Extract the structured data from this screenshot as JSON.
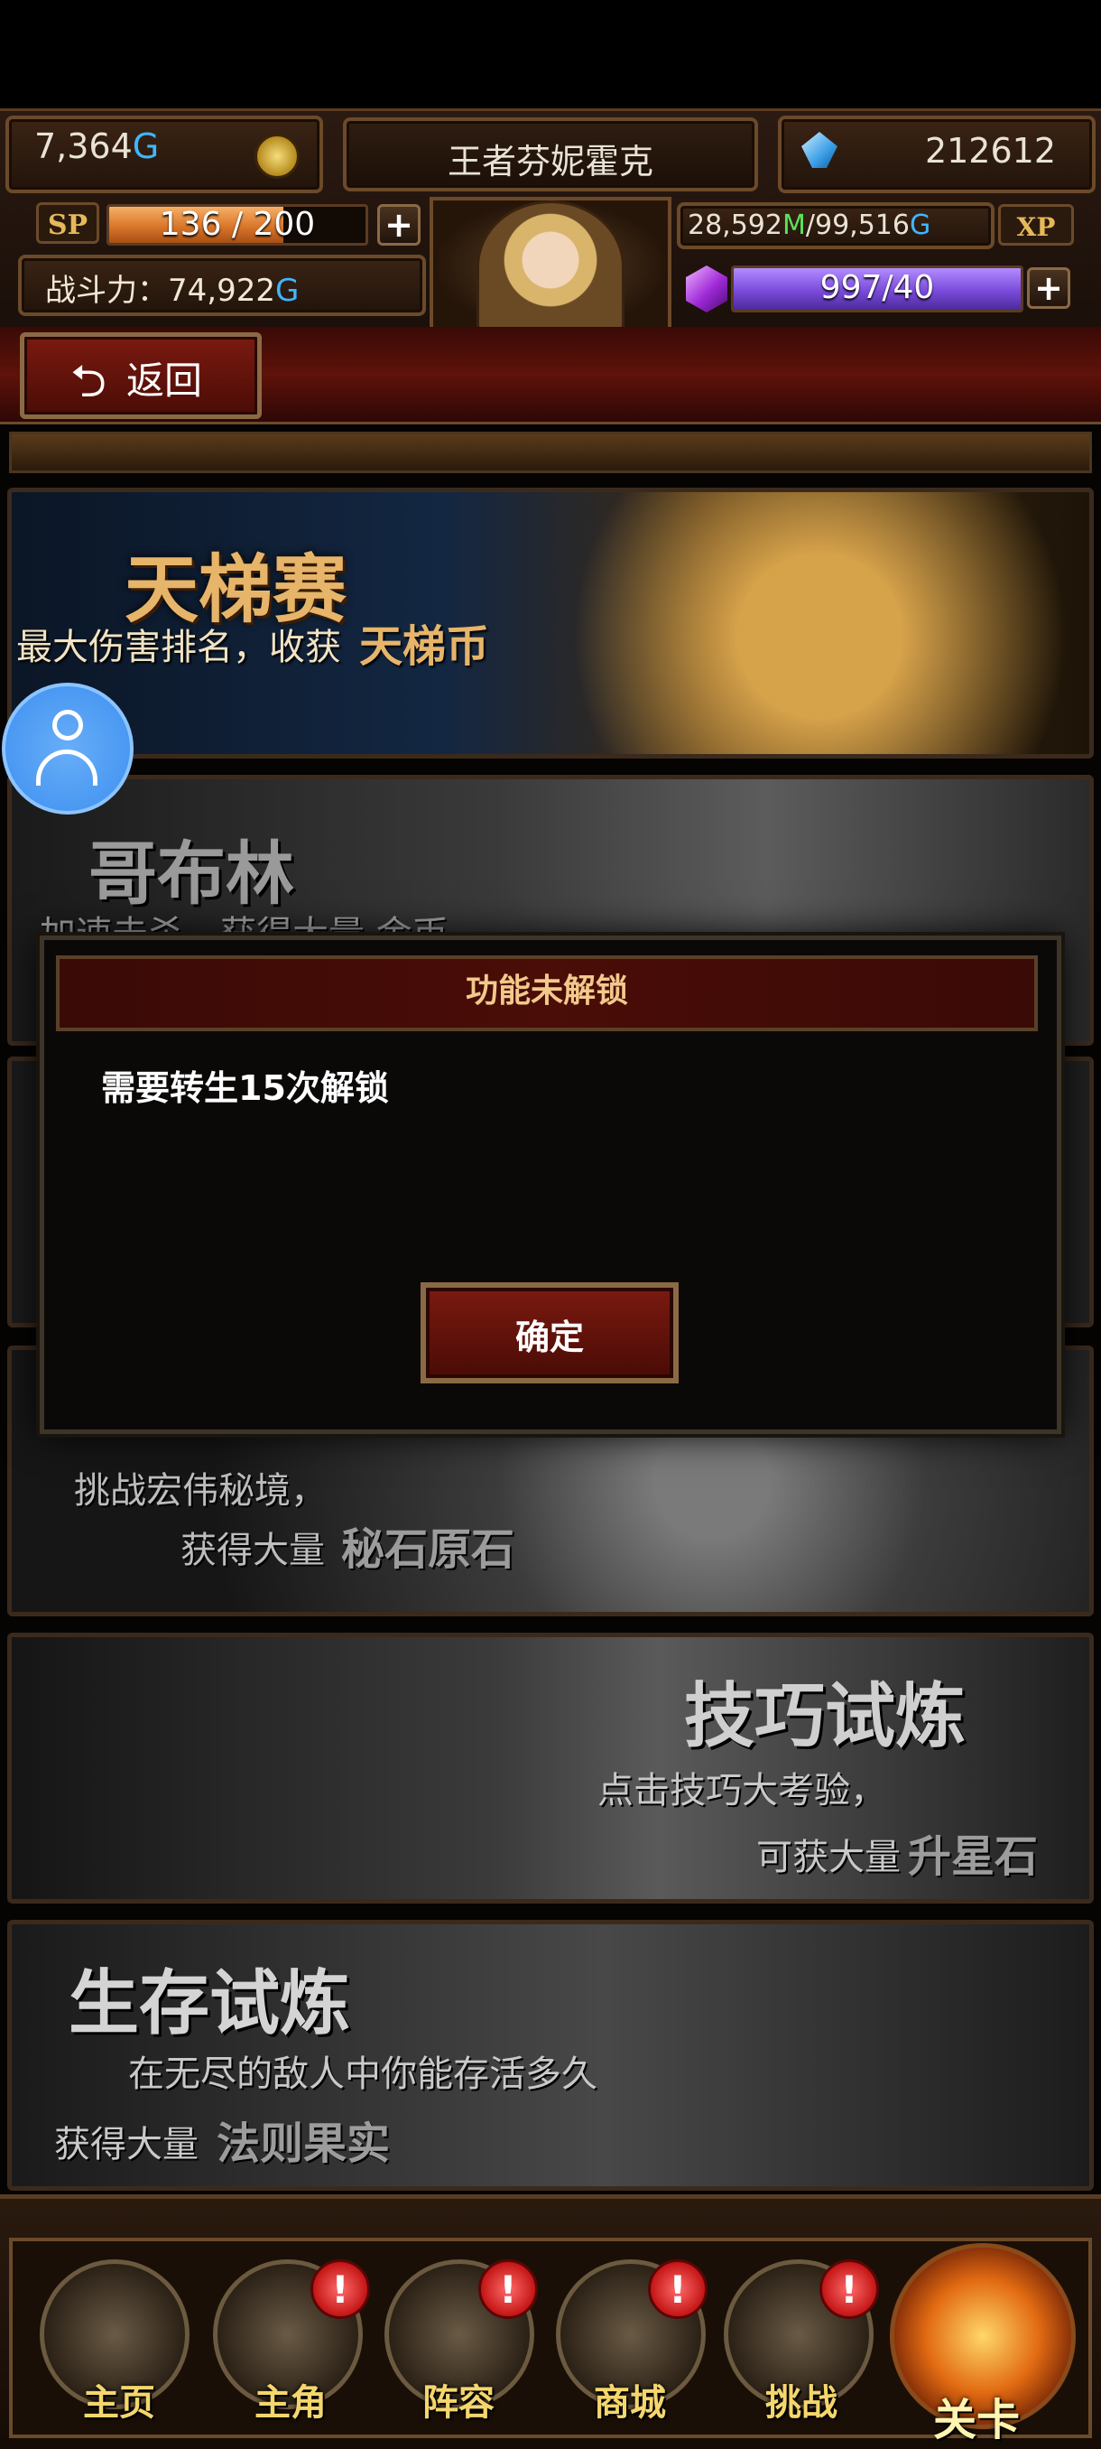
{
  "hud": {
    "gold_amount": "7,364",
    "gold_unit": "G",
    "player_name": "王者芬妮霍克",
    "gems": "212612",
    "sp_label": "SP",
    "sp_value": "136 / 200",
    "sp_fraction": 0.68,
    "plus": "+",
    "power_label": "战斗力：",
    "power_value": "74,922",
    "power_unit": "G",
    "m_amount": "28,592",
    "m_unit": "M",
    "separator": "/",
    "g_amount": "99,516",
    "g_unit": "G",
    "xp_label": "XP",
    "mana_value": "997/40",
    "mana_fraction": 1.0
  },
  "back": {
    "icon": "back-arrow-icon",
    "arrow": "⮌",
    "label": "返回"
  },
  "banners": {
    "ladder_title": "天梯赛",
    "ladder_desc": "最大伤害排名，收获",
    "ladder_reward": "天梯币",
    "goblin_title": "哥布林",
    "goblin_desc": "加速击杀，获得大量 金币",
    "secret_desc1": "挑战宏伟秘境，",
    "secret_desc2": "获得大量",
    "secret_reward": "秘石原石",
    "skill_title": "技巧试炼",
    "skill_desc1": "点击技巧大考验，",
    "skill_desc2": "可获大量",
    "skill_reward": "升星石",
    "survival_title": "生存试炼",
    "survival_desc1": "在无尽的敌人中你能存活多久",
    "survival_desc2": "获得大量",
    "survival_reward": "法则果实"
  },
  "dialog": {
    "title": "功能未解锁",
    "message": "需要转生15次解锁",
    "confirm": "确定"
  },
  "nav": {
    "alert": "!",
    "items": [
      {
        "label": "主页",
        "icon": "castle-icon"
      },
      {
        "label": "主角",
        "icon": "hero-icon"
      },
      {
        "label": "阵容",
        "icon": "formation-icon"
      },
      {
        "label": "商城",
        "icon": "treasure-chest-icon"
      },
      {
        "label": "挑战",
        "icon": "crossed-swords-icon"
      },
      {
        "label": "关卡",
        "icon": "flame-portal-icon"
      }
    ]
  },
  "colors": {
    "accent_gold": "#e6b56a",
    "blue_g": "#3fb6ff",
    "green_m": "#5be35b",
    "dialog_title": "#f2c98b",
    "nav_label": "#f4d66d",
    "alert_red": "#c41515"
  }
}
